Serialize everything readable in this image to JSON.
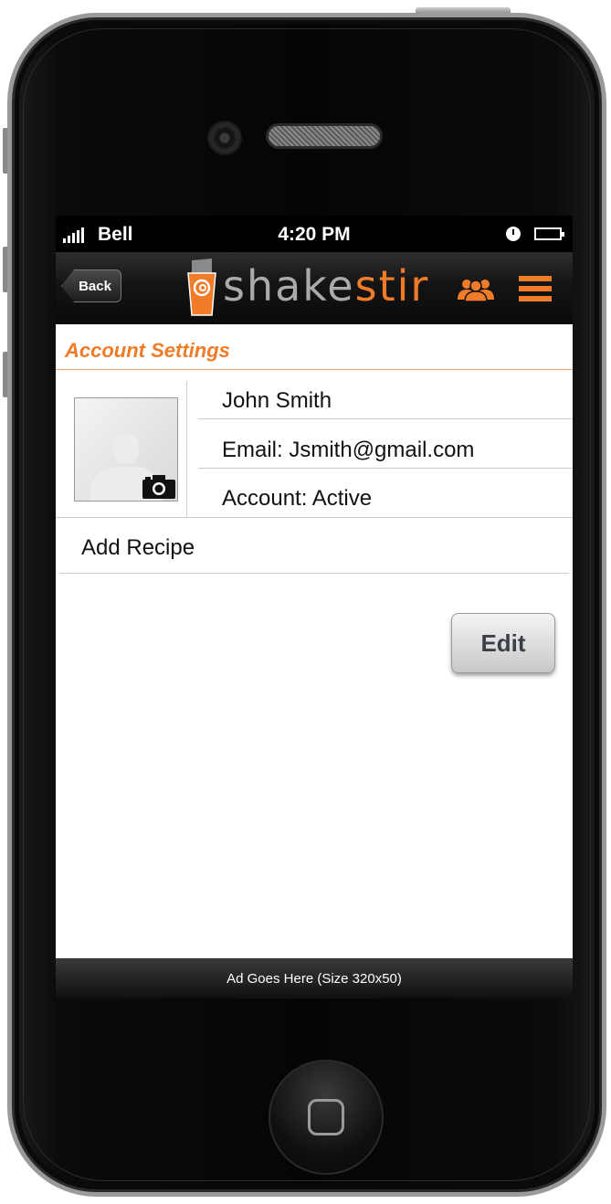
{
  "status_bar": {
    "carrier": "Bell",
    "time": "4:20 PM",
    "battery_level": 0
  },
  "nav": {
    "back_label": "Back",
    "logo_part1": "shake",
    "logo_part2": "stir"
  },
  "icons": {
    "friends": "people-icon",
    "menu": "hamburger-menu-icon",
    "camera": "camera-icon"
  },
  "colors": {
    "brand_orange": "#f07c2a",
    "logo_gray": "#aaaaaa",
    "navbar": "#141414"
  },
  "page": {
    "title": "Account Settings"
  },
  "profile": {
    "name": "John Smith",
    "email": "Email: Jsmith@gmail.com",
    "account_status": "Account: Active"
  },
  "actions": {
    "add_recipe": "Add Recipe",
    "edit_label": "Edit"
  },
  "ad": {
    "text": "Ad Goes Here (Size 320x50)"
  }
}
